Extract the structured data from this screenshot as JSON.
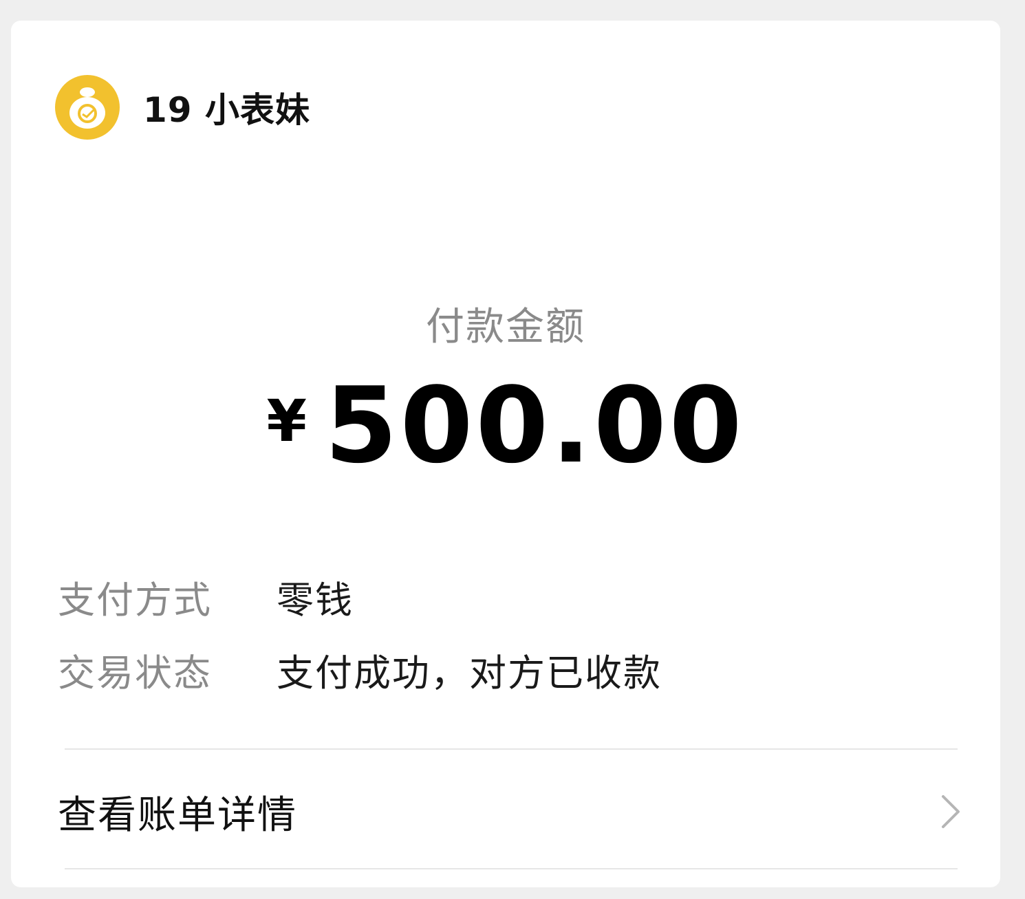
{
  "merchant": {
    "name": "19 小表妹",
    "icon": "wallet-bag-icon",
    "avatar_color": "#f2c12e"
  },
  "payment": {
    "amount_label": "付款金额",
    "currency": "¥",
    "amount": "500.00"
  },
  "info": [
    {
      "key": "支付方式",
      "value": "零钱"
    },
    {
      "key": "交易状态",
      "value": "支付成功，对方已收款"
    }
  ],
  "details": {
    "label": "查看账单详情",
    "icon": "chevron-right-icon"
  }
}
